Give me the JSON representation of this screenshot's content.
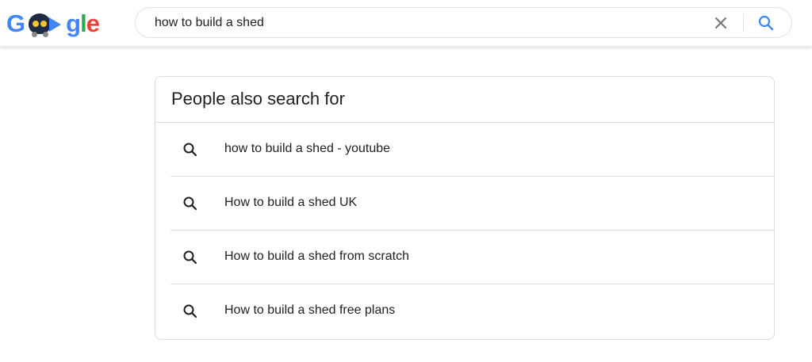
{
  "header": {
    "logo_text": "Google",
    "search": {
      "query": "how to build a shed",
      "clear_icon": "close-icon",
      "search_icon": "search-icon",
      "accent_color": "#4285f4"
    }
  },
  "related": {
    "title": "People also search for",
    "items": [
      {
        "label": "how to build a shed - youtube",
        "icon": "search-icon"
      },
      {
        "label": "How to build a shed UK",
        "icon": "search-icon"
      },
      {
        "label": "How to build a shed from scratch",
        "icon": "search-icon"
      },
      {
        "label": "How to build a shed free plans",
        "icon": "search-icon"
      }
    ]
  }
}
